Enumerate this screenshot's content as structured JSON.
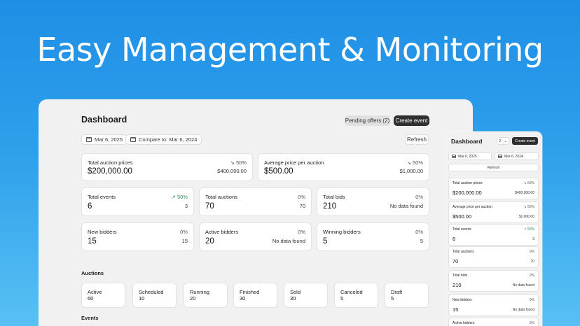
{
  "hero": {
    "title": "Easy Management & Monitoring"
  },
  "dashboard": {
    "title": "Dashboard",
    "pending_offers_label": "Pending offers (2)",
    "create_event_label": "Create event",
    "date_label": "Mar 6, 2025",
    "compare_label": "Compare to: Mar 6, 2024",
    "refresh_label": "Refresh",
    "top_cards": [
      {
        "label": "Total auction prices",
        "change": "↘ 50%",
        "value": "$200,000.00",
        "compare": "$400,000.00"
      },
      {
        "label": "Average price per auction",
        "change": "↘ 50%",
        "value": "$500.00",
        "compare": "$1,000.00"
      }
    ],
    "stat_cards": [
      {
        "label": "Total events",
        "change": "↗ 50%",
        "value": "6",
        "compare": "3"
      },
      {
        "label": "Total auctions",
        "change": "0%",
        "value": "70",
        "compare": "70"
      },
      {
        "label": "Total bids",
        "change": "0%",
        "value": "210",
        "compare": "No data found"
      },
      {
        "label": "New bidders",
        "change": "0%",
        "value": "15",
        "compare": "15"
      },
      {
        "label": "Active bidders",
        "change": "0%",
        "value": "20",
        "compare": "No data found"
      },
      {
        "label": "Winning bidders",
        "change": "0%",
        "value": "5",
        "compare": "5"
      }
    ],
    "auctions_heading": "Auctions",
    "auction_status": [
      {
        "label": "Active",
        "value": "60"
      },
      {
        "label": "Scheduled",
        "value": "10"
      },
      {
        "label": "Running",
        "value": "20"
      },
      {
        "label": "Finished",
        "value": "30"
      },
      {
        "label": "Sold",
        "value": "30"
      },
      {
        "label": "Canceled",
        "value": "5"
      },
      {
        "label": "Draft",
        "value": "5"
      }
    ],
    "events_heading": "Events"
  },
  "mobile": {
    "title": "Dashboard",
    "pending_count": "2",
    "create_event_label": "Create event",
    "date_label": "Mar 6, 2025",
    "compare_label": "Mar 6, 2024",
    "refresh_label": "Refresh",
    "cards": [
      {
        "label": "Total auction prices",
        "change": "↘ 50%",
        "value": "$200,000.00",
        "compare": "$400,000.00"
      },
      {
        "label": "Average price per auction",
        "change": "↘ 50%",
        "value": "$500.00",
        "compare": "$1,000.00"
      },
      {
        "label": "Total events",
        "change": "↗ 50%",
        "value": "6",
        "compare": "3"
      },
      {
        "label": "Total auctions",
        "change": "0%",
        "value": "70",
        "compare": "70"
      },
      {
        "label": "Total bids",
        "change": "0%",
        "value": "210",
        "compare": "No data found"
      },
      {
        "label": "New bidders",
        "change": "0%",
        "value": "15",
        "compare": "No data found"
      },
      {
        "label": "Active bidders",
        "change": "0%",
        "value": "",
        "compare": ""
      }
    ]
  },
  "colors": {
    "accent_up": "#2e8b57",
    "primary_button": "#2f2f2f",
    "background_top": "#1f8fe6"
  }
}
